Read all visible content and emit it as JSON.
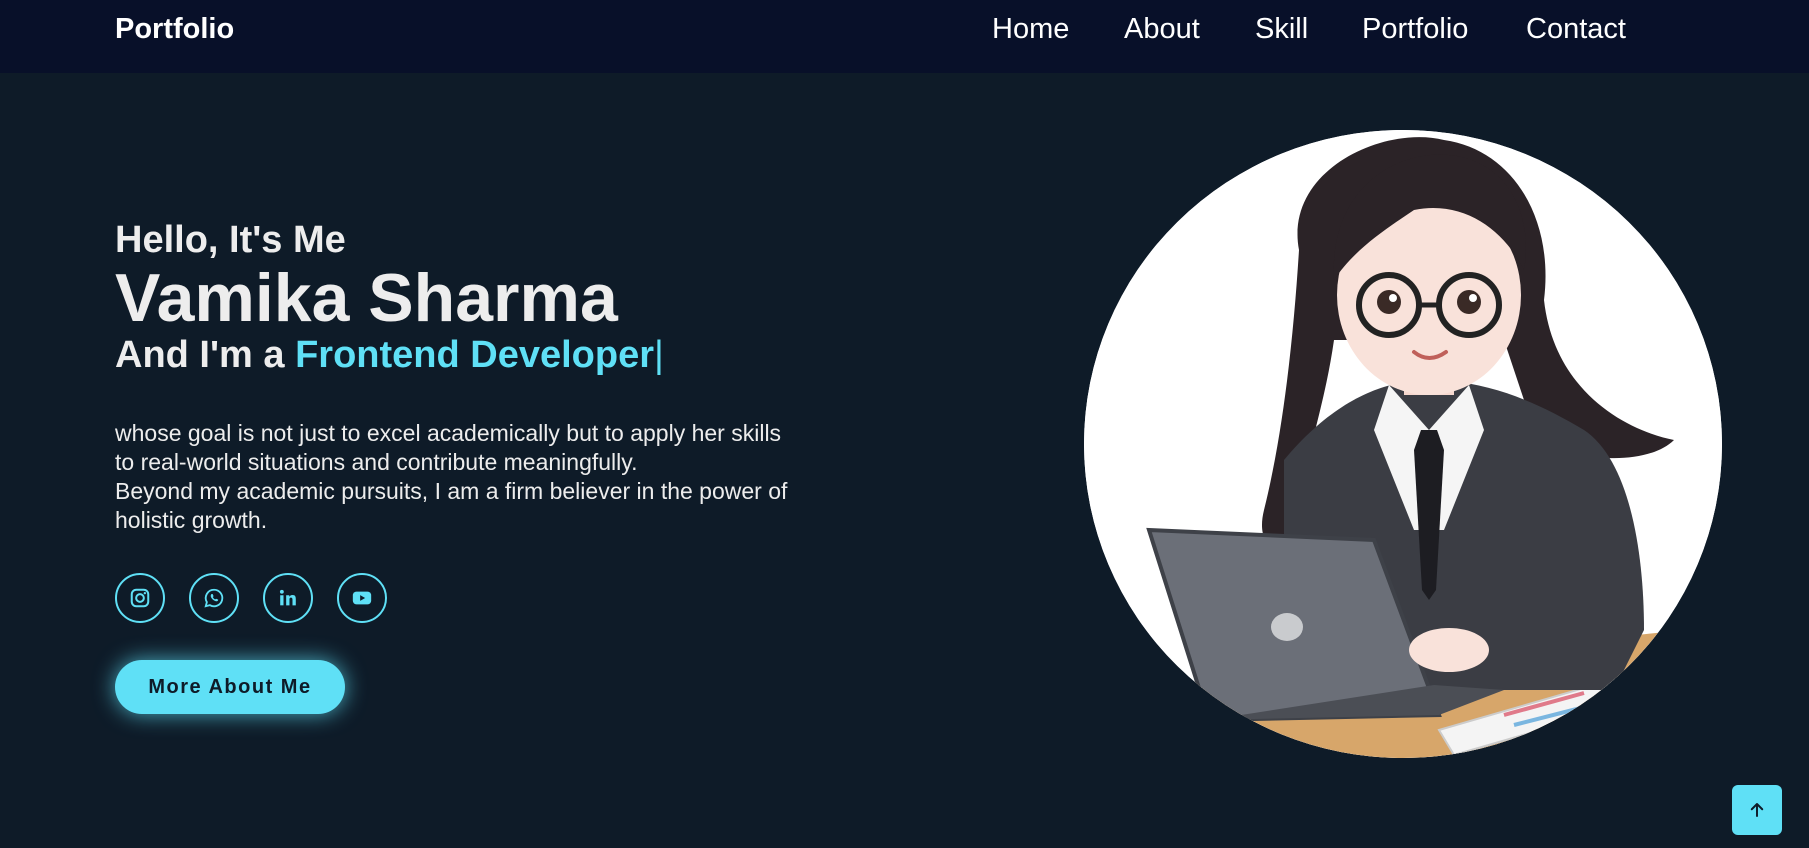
{
  "navbar": {
    "logo": "Portfolio",
    "links": [
      "Home",
      "About",
      "Skill",
      "Portfolio",
      "Contact"
    ]
  },
  "hero": {
    "greeting": "Hello, It's Me",
    "name": "Vamika Sharma",
    "role_prefix": "And I'm a ",
    "role_highlight": "Frontend Developer",
    "cursor": "|",
    "description_lines": [
      "whose goal is not just to excel academically but to apply her skills",
      "to real-world situations and contribute meaningfully.",
      "Beyond my academic pursuits, I am a firm believer in the power of",
      "holistic growth."
    ],
    "button_label": "More About Me"
  },
  "socials": [
    "instagram-icon",
    "whatsapp-icon",
    "linkedin-icon",
    "youtube-icon"
  ],
  "colors": {
    "background": "#0e1b28",
    "navbar": "#081029",
    "accent": "#5fe0f6",
    "text": "#ededed"
  },
  "scroll_top_icon": "arrow-up-icon"
}
